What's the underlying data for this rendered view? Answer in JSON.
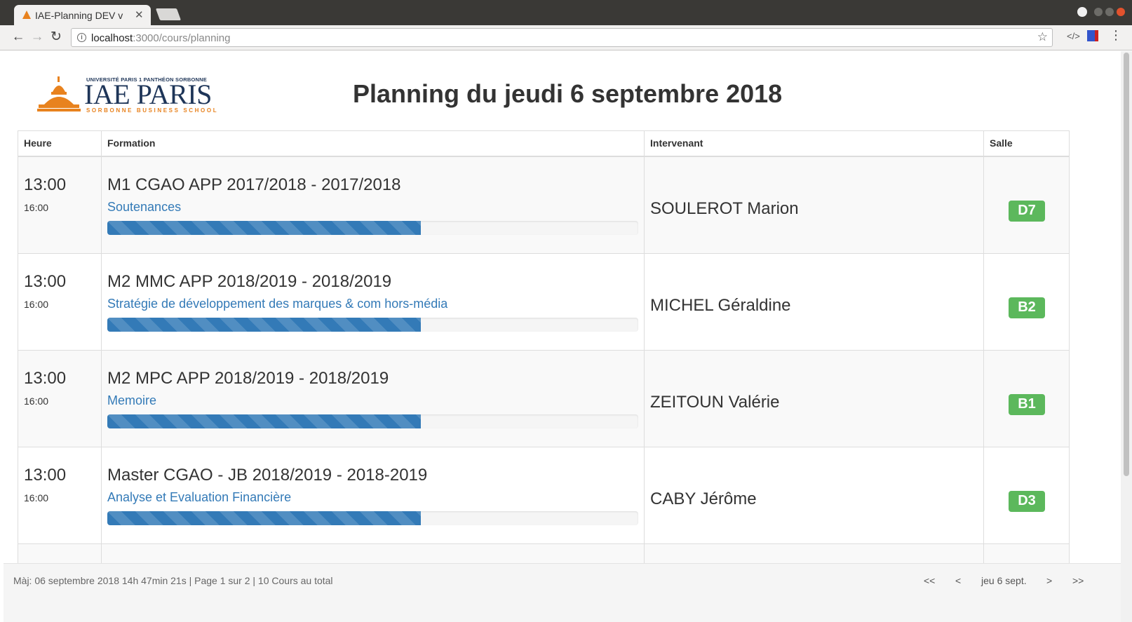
{
  "browser": {
    "tab_title": "IAE-Planning DEV v",
    "url_host": "localhost",
    "url_path": ":3000/cours/planning"
  },
  "logo": {
    "top_line": "UNIVERSITÉ PARIS 1 PANTHÉON SORBONNE",
    "main": "IAE PARIS",
    "sub": "SORBONNE BUSINESS SCHOOL"
  },
  "page": {
    "title": "Planning du jeudi 6 septembre 2018"
  },
  "table": {
    "headers": [
      "Heure",
      "Formation",
      "Intervenant",
      "Salle"
    ],
    "rows": [
      {
        "start": "13:00",
        "end": "16:00",
        "formation": "M1 CGAO APP 2017/2018 - 2017/2018",
        "course": "Soutenances",
        "progress": 0.59,
        "intervenant": "SOULEROT Marion",
        "salle": "D7"
      },
      {
        "start": "13:00",
        "end": "16:00",
        "formation": "M2 MMC APP 2018/2019 - 2018/2019",
        "course": "Stratégie de développement des marques & com hors-média",
        "progress": 0.59,
        "intervenant": "MICHEL Géraldine",
        "salle": "B2"
      },
      {
        "start": "13:00",
        "end": "16:00",
        "formation": "M2 MPC APP 2018/2019 - 2018/2019",
        "course": "Memoire",
        "progress": 0.59,
        "intervenant": "ZEITOUN Valérie",
        "salle": "B1"
      },
      {
        "start": "13:00",
        "end": "16:00",
        "formation": "Master CGAO - JB 2018/2019 - 2018-2019",
        "course": "Analyse et Evaluation Financière",
        "progress": 0.59,
        "intervenant": "CABY Jérôme",
        "salle": "D3"
      }
    ]
  },
  "footer": {
    "status": "Màj: 06 septembre 2018 14h 47min 21s | Page 1 sur 2 | 10 Cours au total",
    "first": "<<",
    "prev": "<",
    "current": "jeu 6 sept.",
    "next": ">",
    "last": ">>"
  },
  "colors": {
    "progress": "#337ab7",
    "badge": "#5cb85c",
    "link": "#337ab7",
    "logo_blue": "#1e3558",
    "logo_orange": "#e8821e"
  }
}
